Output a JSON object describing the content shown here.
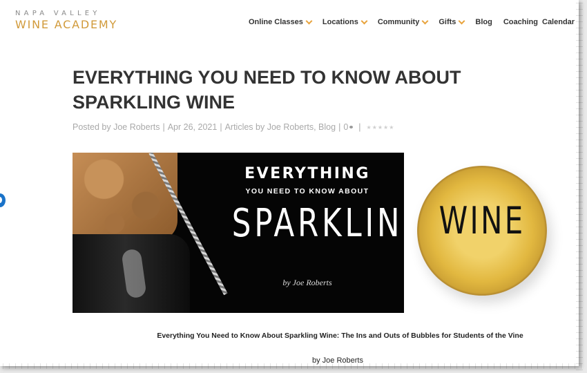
{
  "logo": {
    "line1": "NAPA VALLEY",
    "line2": "WINE ACADEMY"
  },
  "nav": {
    "items": [
      {
        "label": "Online Classes",
        "dropdown": true
      },
      {
        "label": "Locations",
        "dropdown": true
      },
      {
        "label": "Community",
        "dropdown": true
      },
      {
        "label": "Gifts",
        "dropdown": true
      },
      {
        "label": "Blog",
        "dropdown": false
      },
      {
        "label": "Coaching",
        "dropdown": false
      }
    ],
    "calendar": "Calendar"
  },
  "article": {
    "title": "EVERYTHING YOU NEED TO KNOW ABOUT SPARKLING WINE",
    "meta": {
      "posted_by": "Posted by Joe Roberts",
      "date": "Apr 26, 2021",
      "categories": "Articles by Joe Roberts, Blog",
      "comments": "0",
      "rating_stars": 5
    },
    "hero": {
      "line1": "EVERYTHING",
      "line2": "YOU NEED TO KNOW ABOUT",
      "line3": "SPARKLING",
      "line4": "by Joe Roberts",
      "glass_word": "WINE"
    },
    "caption": "Everything You Need to Know About Sparkling Wine: The Ins and Outs of Bubbles for Students of the Vine",
    "byline": "by Joe Roberts"
  },
  "colors": {
    "accent": "#d19a3a",
    "chevron": "#e8a33d",
    "text": "#333333",
    "meta": "#a9a9a9"
  }
}
